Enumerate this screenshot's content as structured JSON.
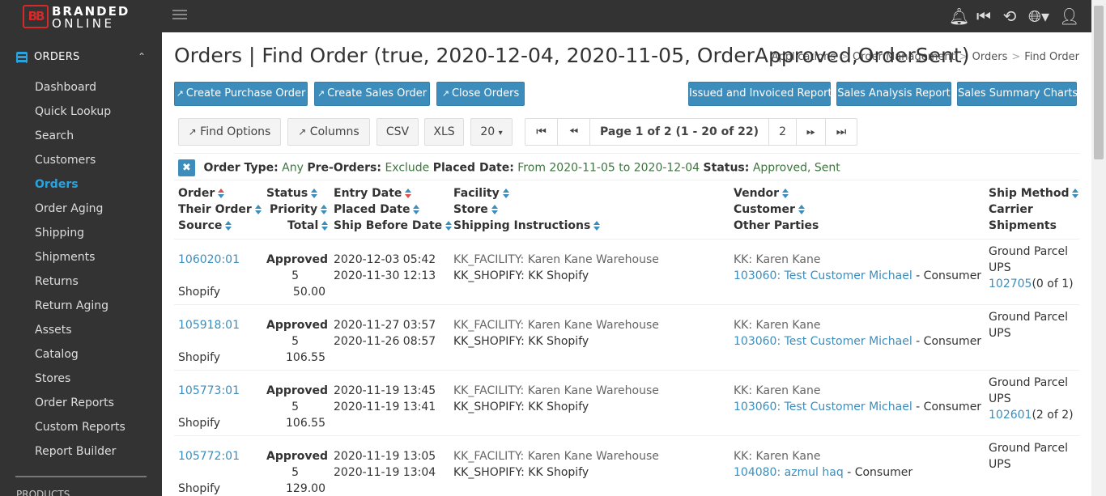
{
  "brand": {
    "line1": "BRANDED",
    "line2": "ONLINE",
    "mark": "BB",
    "mark_color": "#d42a2a"
  },
  "colors": {
    "accent": "#3c8dbc",
    "sidebar_bg": "#333333",
    "filter_value": "#3c763d",
    "sort_active": "#d9534f"
  },
  "topbar": {
    "icons": [
      "bell-icon",
      "skip-back-icon",
      "history-icon",
      "globe-icon",
      "user-icon"
    ]
  },
  "sidebar": {
    "section": "ORDERS",
    "items": [
      {
        "label": "Dashboard",
        "active": false
      },
      {
        "label": "Quick Lookup",
        "active": false
      },
      {
        "label": "Search",
        "active": false
      },
      {
        "label": "Customers",
        "active": false
      },
      {
        "label": "Orders",
        "active": true
      },
      {
        "label": "Order Aging",
        "active": false
      },
      {
        "label": "Shipping",
        "active": false
      },
      {
        "label": "Shipments",
        "active": false
      },
      {
        "label": "Returns",
        "active": false
      },
      {
        "label": "Return Aging",
        "active": false
      },
      {
        "label": "Assets",
        "active": false
      },
      {
        "label": "Catalog",
        "active": false
      },
      {
        "label": "Stores",
        "active": false
      },
      {
        "label": "Order Reports",
        "active": false
      },
      {
        "label": "Custom Reports",
        "active": false
      },
      {
        "label": "Report Builder",
        "active": false
      }
    ],
    "next_section": "PRODUCTS"
  },
  "page": {
    "title": "Orders | Find Order (true, 2020-12-04, 2020-11-05, OrderApproved,OrderSent)",
    "breadcrumb": [
      "Applications",
      "Order Management",
      "Orders",
      "Find Order"
    ]
  },
  "actions": {
    "create_po": "Create Purchase Order",
    "create_so": "Create Sales Order",
    "close_orders": "Close Orders",
    "issued_report": "Issued and Invoiced Report",
    "sales_analysis": "Sales Analysis Report",
    "sales_summary": "Sales Summary Charts"
  },
  "toolbar": {
    "find_options": "Find Options",
    "columns": "Columns",
    "csv": "CSV",
    "xls": "XLS",
    "page_size": "20",
    "page_info": "Page 1 of 2 (1 - 20 of 22)",
    "next_page_num": "2"
  },
  "filters": {
    "order_type_label": "Order Type:",
    "order_type": "Any",
    "preorders_label": "Pre-Orders:",
    "preorders": "Exclude",
    "placed_label": "Placed Date:",
    "placed": "From 2020-11-05 to 2020-12-04",
    "status_label": "Status:",
    "status": "Approved, Sent"
  },
  "table": {
    "headers": {
      "order": "Order",
      "their_order": "Their Order",
      "source": "Source",
      "status": "Status",
      "priority": "Priority",
      "total": "Total",
      "entry_date": "Entry Date",
      "placed_date": "Placed Date",
      "ship_before": "Ship Before Date",
      "facility": "Facility",
      "store": "Store",
      "shipping_instr": "Shipping Instructions",
      "vendor": "Vendor",
      "customer": "Customer",
      "other_parties": "Other Parties",
      "ship_method": "Ship Method",
      "carrier": "Carrier",
      "shipments": "Shipments"
    },
    "rows": [
      {
        "order": "106020:01",
        "source": "Shopify",
        "status": "Approved",
        "priority": "5",
        "total": "50.00",
        "entry": "2020-12-03 05:42",
        "placed": "2020-11-30 12:13",
        "facility": "KK_FACILITY: Karen Kane Warehouse",
        "store": "KK_SHOPIFY: KK Shopify",
        "vendor": "KK: Karen Kane",
        "customer": "103060: Test Customer Michael",
        "customer_role": "- Consumer",
        "ship_method": "Ground Parcel",
        "carrier": "UPS",
        "shipment_link": "102705",
        "shipment_count": "(0 of 1)"
      },
      {
        "order": "105918:01",
        "source": "Shopify",
        "status": "Approved",
        "priority": "5",
        "total": "106.55",
        "entry": "2020-11-27 03:57",
        "placed": "2020-11-26 08:57",
        "facility": "KK_FACILITY: Karen Kane Warehouse",
        "store": "KK_SHOPIFY: KK Shopify",
        "vendor": "KK: Karen Kane",
        "customer": "103060: Test Customer Michael",
        "customer_role": "- Consumer",
        "ship_method": "Ground Parcel",
        "carrier": "UPS",
        "shipment_link": "",
        "shipment_count": ""
      },
      {
        "order": "105773:01",
        "source": "Shopify",
        "status": "Approved",
        "priority": "5",
        "total": "106.55",
        "entry": "2020-11-19 13:45",
        "placed": "2020-11-19 13:41",
        "facility": "KK_FACILITY: Karen Kane Warehouse",
        "store": "KK_SHOPIFY: KK Shopify",
        "vendor": "KK: Karen Kane",
        "customer": "103060: Test Customer Michael",
        "customer_role": "- Consumer",
        "ship_method": "Ground Parcel",
        "carrier": "UPS",
        "shipment_link": "102601",
        "shipment_count": "(2 of 2)"
      },
      {
        "order": "105772:01",
        "source": "Shopify",
        "status": "Approved",
        "priority": "5",
        "total": "129.00",
        "entry": "2020-11-19 13:05",
        "placed": "2020-11-19 13:04",
        "facility": "KK_FACILITY: Karen Kane Warehouse",
        "store": "KK_SHOPIFY: KK Shopify",
        "vendor": "KK: Karen Kane",
        "customer": "104080: azmul haq",
        "customer_role": "- Consumer",
        "ship_method": "Ground Parcel",
        "carrier": "UPS",
        "shipment_link": "",
        "shipment_count": ""
      }
    ]
  }
}
